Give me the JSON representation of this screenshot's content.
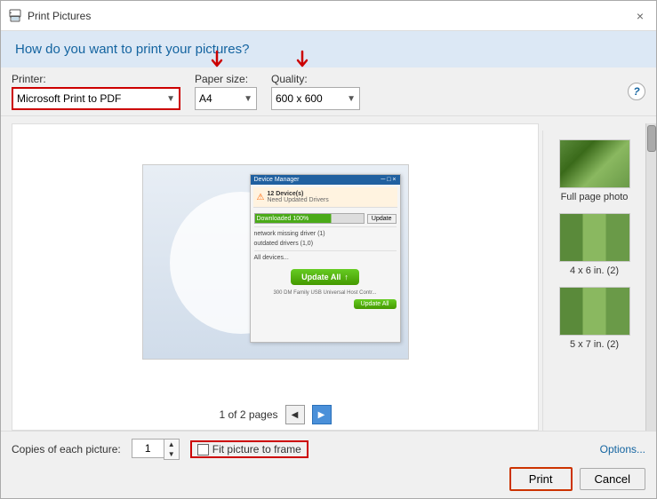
{
  "dialog": {
    "title": "Print Pictures",
    "close_label": "×"
  },
  "header": {
    "text": "How do you want to print your pictures?"
  },
  "toolbar": {
    "printer_label": "Printer:",
    "printer_value": "Microsoft Print to PDF",
    "paper_size_label": "Paper size:",
    "paper_size_value": "A4",
    "quality_label": "Quality:",
    "quality_value": "600 x 600",
    "help_label": "?"
  },
  "preview": {
    "page_text": "1 of 2 pages"
  },
  "thumbnails": [
    {
      "label": "Full page photo",
      "type": "full"
    },
    {
      "label": "4 x 6 in. (2)",
      "type": "4x6"
    },
    {
      "label": "5 x 7 in. (2)",
      "type": "5x7"
    }
  ],
  "bottom": {
    "copies_label": "Copies of each picture:",
    "copies_value": "1",
    "fit_label": "Fit picture to frame",
    "options_label": "Options...",
    "print_label": "Print",
    "cancel_label": "Cancel"
  },
  "screenshot_sim": {
    "alert_text": "12 Device(s)",
    "alert_sub": "Need Updated Drivers",
    "downloaded_text": "Downloaded 100%",
    "update_btn": "Update",
    "update_all_btn": "Update All"
  }
}
